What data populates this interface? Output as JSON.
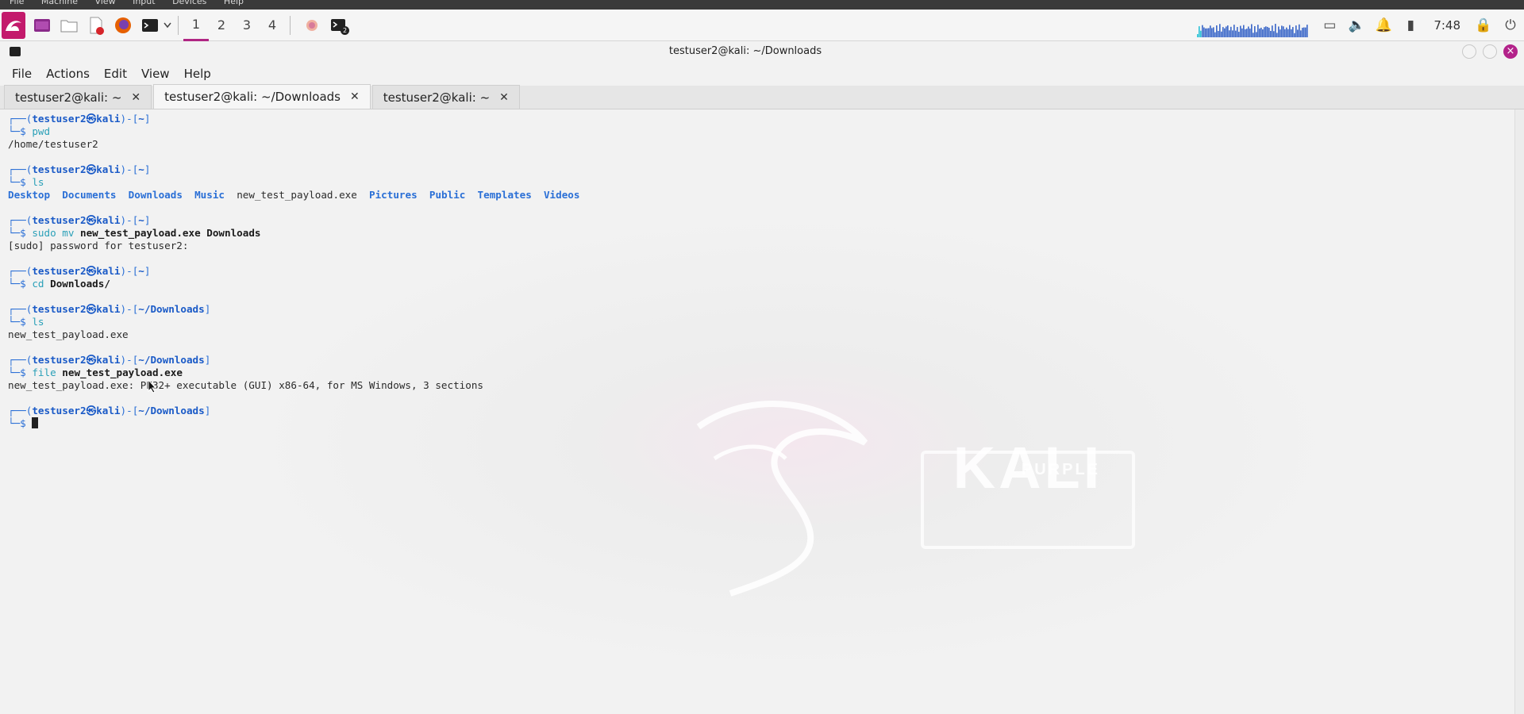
{
  "vm_menu": [
    "File",
    "Machine",
    "View",
    "Input",
    "Devices",
    "Help"
  ],
  "panel": {
    "workspaces": [
      "1",
      "2",
      "3",
      "4"
    ],
    "active_workspace": "1",
    "clock": "7:48",
    "badge": "2"
  },
  "window": {
    "title": "testuser2@kali: ~/Downloads",
    "menu": [
      "File",
      "Actions",
      "Edit",
      "View",
      "Help"
    ],
    "tabs": [
      {
        "label": "testuser2@kali: ~",
        "active": false
      },
      {
        "label": "testuser2@kali: ~/Downloads",
        "active": true
      },
      {
        "label": "testuser2@kali: ~",
        "active": false
      }
    ]
  },
  "terminal": {
    "user": "testuser2",
    "host": "kali",
    "blocks": [
      {
        "dir": "~",
        "cmd": "pwd",
        "args": "",
        "output": [
          "/home/testuser2"
        ]
      },
      {
        "dir": "~",
        "cmd": "ls",
        "args": "",
        "ls_output": [
          "Desktop",
          "Documents",
          "Downloads",
          "Music",
          "new_test_payload.exe",
          "Pictures",
          "Public",
          "Templates",
          "Videos"
        ]
      },
      {
        "dir": "~",
        "cmd": "sudo mv",
        "args": "new_test_payload.exe Downloads",
        "output": [
          "[sudo] password for testuser2:"
        ]
      },
      {
        "dir": "~",
        "cmd": "cd",
        "args": "Downloads/",
        "output": []
      },
      {
        "dir": "~/Downloads",
        "cmd": "ls",
        "args": "",
        "output": [
          "new_test_payload.exe"
        ]
      },
      {
        "dir": "~/Downloads",
        "cmd": "file",
        "args": "new_test_payload.exe",
        "output": [
          "new_test_payload.exe: PE32+ executable (GUI) x86-64, for MS Windows, 3 sections"
        ]
      }
    ],
    "final_dir": "~/Downloads"
  },
  "wallpaper": {
    "word": "KALI",
    "sub": "PURPLE"
  },
  "colors": {
    "accent": "#b02683",
    "prompt": "#2a6fd6",
    "command": "#2aa0b8"
  }
}
